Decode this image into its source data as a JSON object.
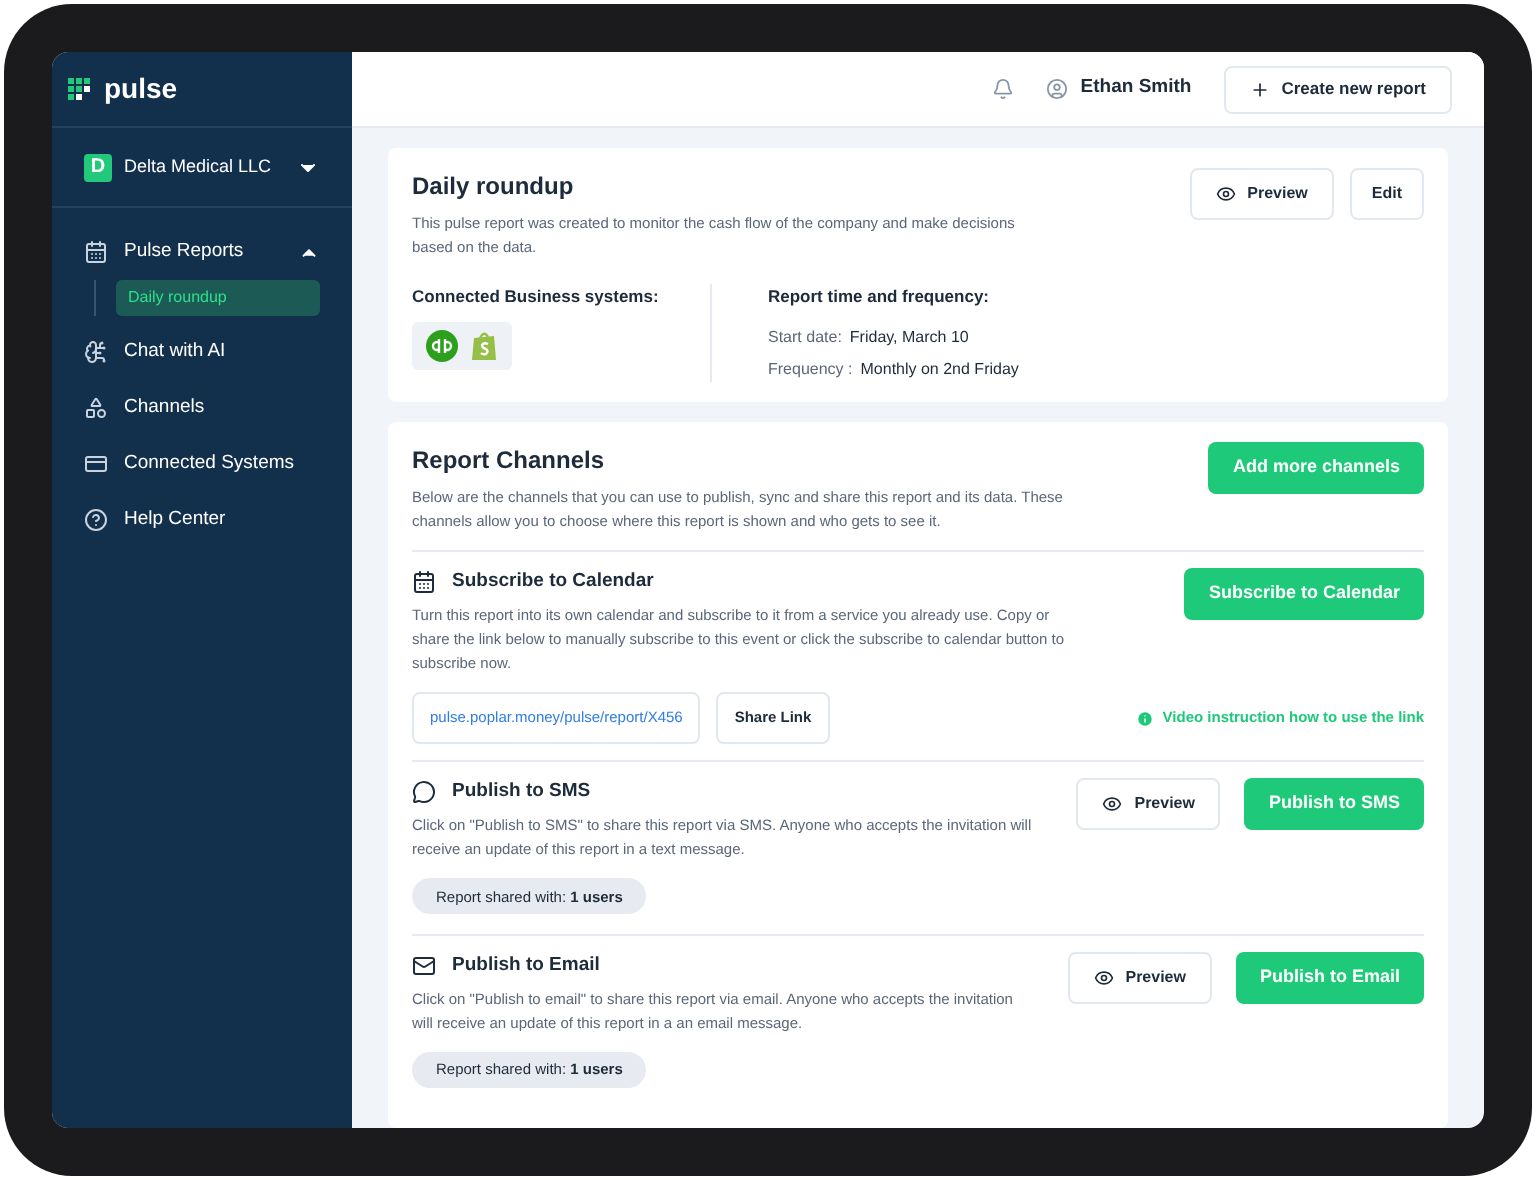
{
  "sidebar": {
    "logo": "pulse",
    "company": {
      "initial": "D",
      "name": "Delta Medical LLC"
    },
    "items": [
      {
        "label": "Pulse Reports",
        "expanded": true,
        "children": [
          {
            "label": "Daily roundup",
            "selected": true
          }
        ]
      },
      {
        "label": "Chat with AI"
      },
      {
        "label": "Channels"
      },
      {
        "label": "Connected Systems"
      },
      {
        "label": "Help Center"
      }
    ]
  },
  "header": {
    "user": "Ethan Smith",
    "create_button": "Create new report"
  },
  "report": {
    "title": "Daily roundup",
    "description": "This pulse report was created to monitor the cash flow of the company and make decisions based on the data.",
    "preview_button": "Preview",
    "edit_button": "Edit",
    "systems_heading": "Connected Business systems:",
    "time_heading": "Report time and frequency:",
    "start_label": "Start date:",
    "start_value": "Friday, March 10",
    "frequency_label": "Frequency :",
    "frequency_value": "Monthly on 2nd Friday"
  },
  "channels": {
    "title": "Report Channels",
    "description": "Below are the channels that you can use to publish, sync and share this report and its data. These channels allow you to choose where this report is shown and who gets to see it.",
    "add_button": "Add more channels",
    "items": [
      {
        "kind": "calendar",
        "title": "Subscribe to Calendar",
        "description": "Turn this report into its own calendar and subscribe to it from a service you already use. Copy or share the link below to manually subscribe to this event or click the subscribe to calendar button to subscribe now.",
        "action_button": "Subscribe to Calendar",
        "link": "pulse.poplar.money/pulse/report/X456",
        "share_button": "Share Link",
        "video_link": "Video instruction how to use the link"
      },
      {
        "kind": "sms",
        "title": "Publish to SMS",
        "description": "Click on \"Publish to SMS\" to share this report via SMS. Anyone who accepts the invitation will receive an update of this report in a text message.",
        "preview_button": "Preview",
        "action_button": "Publish to SMS",
        "shared": "Report shared with: **1 users**"
      },
      {
        "kind": "email",
        "title": "Publish to Email",
        "description": "Click on \"Publish to email\" to share this report via email. Anyone who accepts the invitation will receive an update of this report in a an email message.",
        "preview_button": "Preview",
        "action_button": "Publish to Email",
        "shared": "Report shared with: **1 users**"
      }
    ]
  }
}
